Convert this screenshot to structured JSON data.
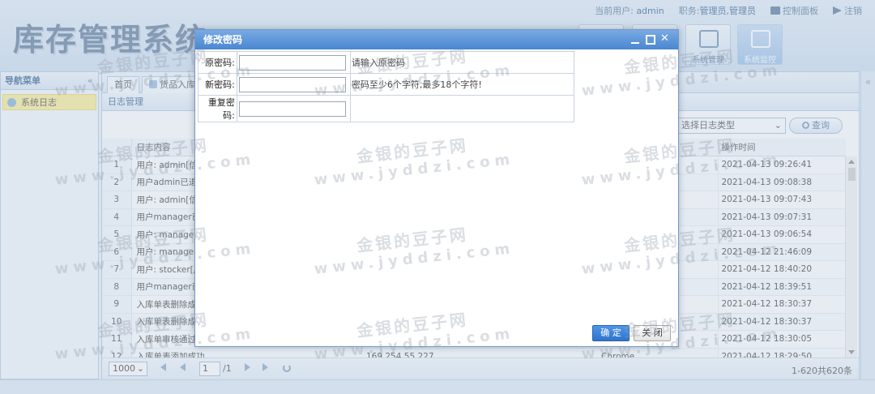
{
  "header": {
    "logo": "库存管理系统",
    "current_user_label": "当前用户:",
    "current_user": "admin",
    "role_label": "职务:",
    "role_value": "管理员,管理员",
    "control_panel": "控制面板",
    "logout": "注销",
    "tools": [
      {
        "label": "系统管理"
      },
      {
        "label": "系统监控"
      }
    ]
  },
  "nav": {
    "title": "导航菜单",
    "collapse": "«",
    "items": [
      {
        "label": "系统日志"
      }
    ]
  },
  "tabs": [
    {
      "label": "首页"
    },
    {
      "label": "货品入库"
    }
  ],
  "panel": {
    "title": "日志管理",
    "select_placeholder": "选择日志类型",
    "query": "查询",
    "expand": "«"
  },
  "grid": {
    "headers": {
      "content": "日志内容",
      "time": "操作时间"
    },
    "rows": [
      {
        "n": "1",
        "content": "用户: admin[信息",
        "ip": "",
        "browser": "",
        "time": "2021-04-13 09:26:41"
      },
      {
        "n": "2",
        "content": "用户admin已退出",
        "ip": "",
        "browser": "",
        "time": "2021-04-13 09:08:38"
      },
      {
        "n": "3",
        "content": "用户: admin[信息",
        "ip": "",
        "browser": "",
        "time": "2021-04-13 09:07:43"
      },
      {
        "n": "4",
        "content": "用户manager已退",
        "ip": "",
        "browser": "",
        "time": "2021-04-13 09:07:31"
      },
      {
        "n": "5",
        "content": "用户: manager[",
        "ip": "",
        "browser": "",
        "time": "2021-04-13 09:06:54"
      },
      {
        "n": "6",
        "content": "用户: manager[",
        "ip": "",
        "browser": "",
        "time": "2021-04-12 21:46:09"
      },
      {
        "n": "7",
        "content": "用户: stocker[库",
        "ip": "",
        "browser": "",
        "time": "2021-04-12 18:40:20"
      },
      {
        "n": "8",
        "content": "用户manager已退",
        "ip": "",
        "browser": "",
        "time": "2021-04-12 18:39:51"
      },
      {
        "n": "9",
        "content": "入库单表删除成功",
        "ip": "",
        "browser": "",
        "time": "2021-04-12 18:30:37"
      },
      {
        "n": "10",
        "content": "入库单表删除成功",
        "ip": "",
        "browser": "",
        "time": "2021-04-12 18:30:37"
      },
      {
        "n": "11",
        "content": "入库单审核通过",
        "ip": "",
        "browser": "",
        "time": "2021-04-12 18:30:05"
      },
      {
        "n": "12",
        "content": "入库单表添加成功",
        "ip": "169.254.55.227",
        "browser": "Chrome",
        "time": "2021-04-12 18:29:50"
      }
    ]
  },
  "pager": {
    "page_size": "1000",
    "page": "1",
    "of": "/1",
    "info": "1-620共620条"
  },
  "modal": {
    "title": "修改密码",
    "old_label": "原密码:",
    "old_hint": "请输入原密码",
    "new_label": "新密码:",
    "new_hint": "密码至少6个字符,最多18个字符!",
    "repeat_label": "重复密码:",
    "ok": "确 定",
    "close": "关 闭",
    "close_x": "✕"
  },
  "watermark": {
    "line1": "金银的豆子网",
    "line2": "www.jyddzi.com"
  },
  "colors": {
    "header_blue": "#4a86d0",
    "nav_highlight": "#fbec88",
    "primary_button": "#2f74cc"
  }
}
